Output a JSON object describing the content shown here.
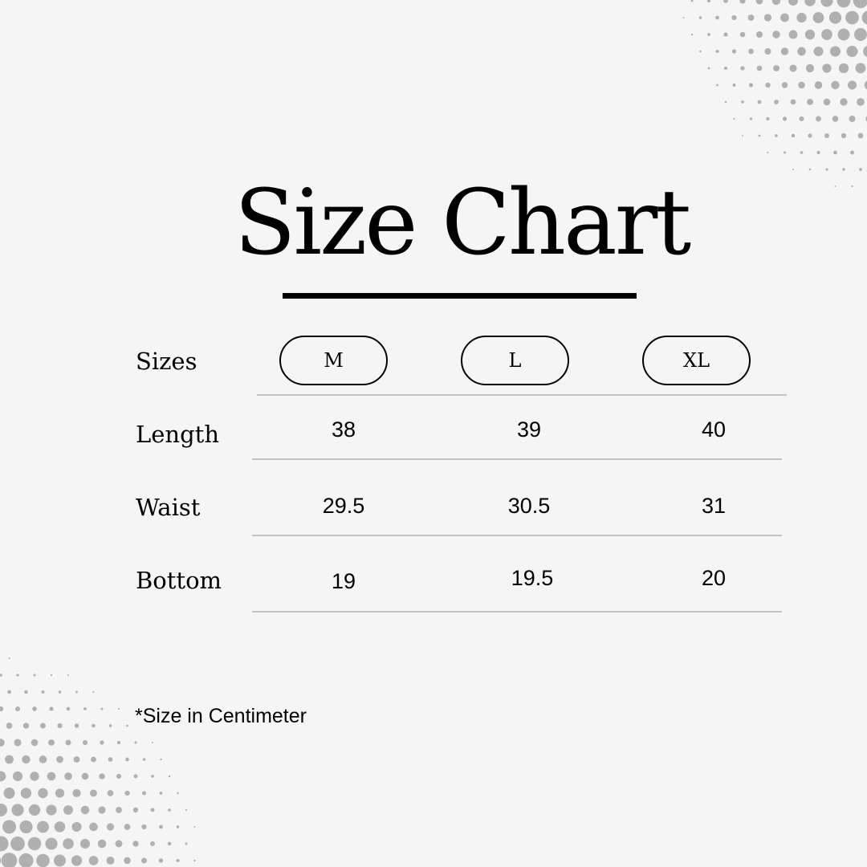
{
  "title": "Size Chart",
  "header_label": "Sizes",
  "sizes": [
    "M",
    "L",
    "XL"
  ],
  "rows": [
    {
      "label": "Length",
      "values": [
        "38",
        "39",
        "40"
      ]
    },
    {
      "label": "Waist",
      "values": [
        "29.5",
        "30.5",
        "31"
      ]
    },
    {
      "label": "Bottom",
      "values": [
        "19",
        "19.5",
        "20"
      ]
    }
  ],
  "footnote": "*Size in Centimeter",
  "colors": {
    "background": "#f5f5f5",
    "text": "#000000",
    "rule": "#c3c3c3",
    "dots": "#b0b0b0"
  }
}
